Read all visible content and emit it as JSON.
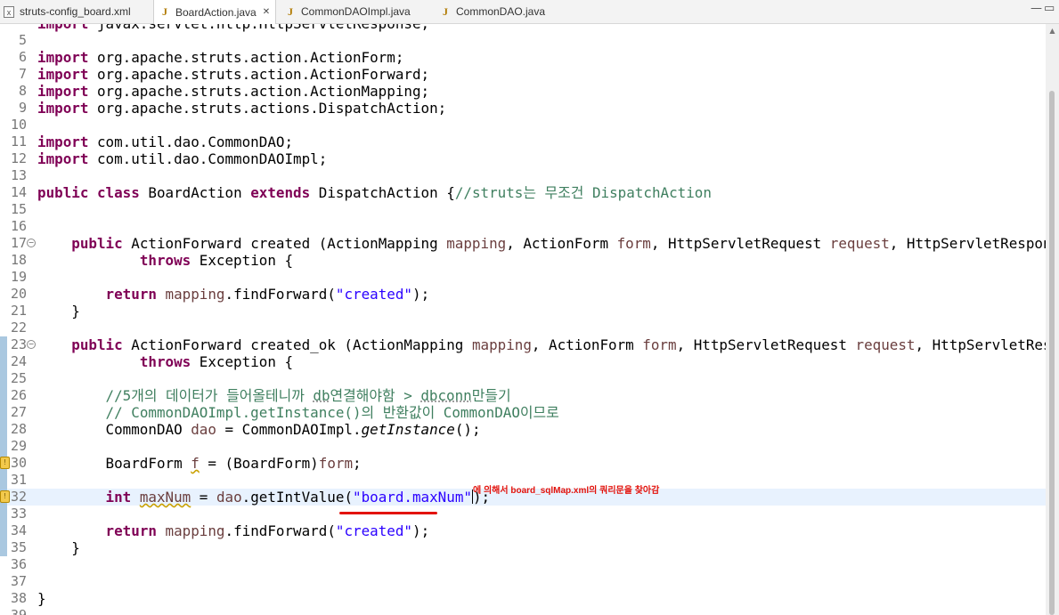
{
  "tabs": [
    {
      "label": "struts-config_board.xml",
      "icon": "xml-file-icon",
      "active": false
    },
    {
      "label": "BoardAction.java",
      "icon": "java-file-icon",
      "active": true,
      "close": "✕"
    },
    {
      "label": "CommonDAOImpl.java",
      "icon": "java-file-icon",
      "active": false
    },
    {
      "label": "CommonDAO.java",
      "icon": "java-file-icon",
      "active": false
    }
  ],
  "window_controls": {
    "minimize": "—",
    "maximize": "▭"
  },
  "editor": {
    "lines": [
      {
        "n": "",
        "text": "import javax.servlet.http.HttpServletResponse;"
      },
      {
        "n": "5"
      },
      {
        "n": "6",
        "text": "import org.apache.struts.action.ActionForm;"
      },
      {
        "n": "7",
        "text": "import org.apache.struts.action.ActionForward;"
      },
      {
        "n": "8",
        "text": "import org.apache.struts.action.ActionMapping;"
      },
      {
        "n": "9",
        "text": "import org.apache.struts.actions.DispatchAction;"
      },
      {
        "n": "10"
      },
      {
        "n": "11",
        "text": "import com.util.dao.CommonDAO;"
      },
      {
        "n": "12",
        "text": "import com.util.dao.CommonDAOImpl;"
      },
      {
        "n": "13"
      },
      {
        "n": "14",
        "text": "public class BoardAction extends DispatchAction {//struts는 무조건 DispatchAction"
      },
      {
        "n": "15"
      },
      {
        "n": "16"
      },
      {
        "n": "17",
        "text": "    public ActionForward created (ActionMapping mapping, ActionForm form, HttpServletRequest request, HttpServletResponse resp"
      },
      {
        "n": "18",
        "text": "            throws Exception {"
      },
      {
        "n": "19"
      },
      {
        "n": "20",
        "text": "        return mapping.findForward(\"created\");"
      },
      {
        "n": "21",
        "text": "    }"
      },
      {
        "n": "22"
      },
      {
        "n": "23",
        "text": "    public ActionForward created_ok (ActionMapping mapping, ActionForm form, HttpServletRequest request, HttpServletResponse r"
      },
      {
        "n": "24",
        "text": "            throws Exception {"
      },
      {
        "n": "25"
      },
      {
        "n": "26",
        "text": "        //5개의 데이터가 들어올테니까 db연결해야함 > dbconn만들기"
      },
      {
        "n": "27",
        "text": "        // CommonDAOImpl.getInstance()의 반환값이 CommonDAO이므로"
      },
      {
        "n": "28",
        "text": "        CommonDAO dao = CommonDAOImpl.getInstance();"
      },
      {
        "n": "29"
      },
      {
        "n": "30",
        "text": "        BoardForm f = (BoardForm)form;"
      },
      {
        "n": "31"
      },
      {
        "n": "32",
        "text": "        int maxNum = dao.getIntValue(\"board.maxNum\");"
      },
      {
        "n": "33"
      },
      {
        "n": "34",
        "text": "        return mapping.findForward(\"created\");"
      },
      {
        "n": "35",
        "text": "    }"
      },
      {
        "n": "36"
      },
      {
        "n": "37"
      },
      {
        "n": "38",
        "text": "}"
      },
      {
        "n": "39"
      }
    ]
  },
  "annotation": {
    "text": "에 의해서 board_sqlMap.xml의 쿼리문을 찾아감",
    "color": "#e3120b"
  },
  "colors": {
    "keyword": "#7f0055",
    "comment": "#3f7f5f",
    "string": "#2a00ff",
    "variable": "#6a3e3e",
    "current_line": "#e8f2fe"
  }
}
